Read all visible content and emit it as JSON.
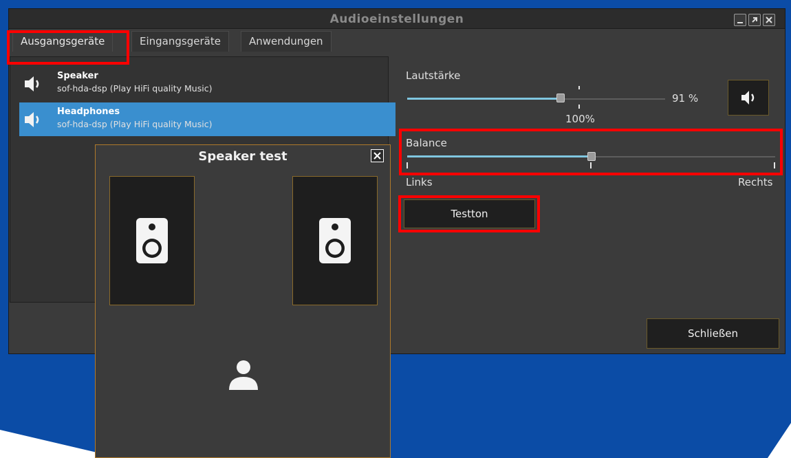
{
  "window": {
    "title": "Audioeinstellungen",
    "controls": [
      "minimize-icon",
      "restore-icon",
      "close-icon"
    ]
  },
  "tabs": [
    {
      "label": "Ausgangsgeräte",
      "active": true
    },
    {
      "label": "Eingangsgeräte",
      "active": false
    },
    {
      "label": "Anwendungen",
      "active": false
    }
  ],
  "devices": [
    {
      "name": "Speaker",
      "description": "sof-hda-dsp (Play HiFi quality Music)",
      "icon": "speaker-volume-icon",
      "selected": false
    },
    {
      "name": "Headphones",
      "description": "sof-hda-dsp (Play HiFi quality Music)",
      "icon": "speaker-volume-icon",
      "selected": true
    }
  ],
  "volume": {
    "label": "Lautstärke",
    "value_text": "91 %",
    "value_fraction": 0.91,
    "reference_mark": "100%",
    "mute_icon": "speaker-volume-icon"
  },
  "balance": {
    "label": "Balance",
    "left_label": "Links",
    "right_label": "Rechts",
    "value_fraction": 0.5
  },
  "test_button": {
    "label": "Testton"
  },
  "close_button": {
    "label": "Schließen"
  },
  "speaker_test": {
    "title": "Speaker test",
    "close_icon": "close-icon",
    "speakers": [
      "left-speaker-icon",
      "right-speaker-icon"
    ],
    "listener_icon": "person-icon"
  },
  "colors": {
    "selection": "#3a8fcf",
    "slider_fill": "#7fc6e0",
    "highlight": "#ff0000",
    "desktop": "#0a4aa8",
    "window_bg": "#3b3b3b"
  }
}
